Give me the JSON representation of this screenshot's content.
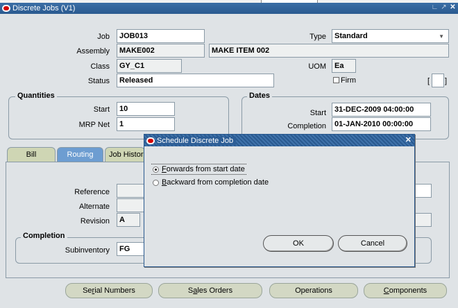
{
  "window": {
    "title": "Discrete Jobs (V1)"
  },
  "header": {
    "job_label": "Job",
    "job_value": "JOB013",
    "type_label": "Type",
    "type_value": "Standard",
    "assembly_label": "Assembly",
    "assembly_value": "MAKE002",
    "assembly_desc": "MAKE ITEM 002",
    "class_label": "Class",
    "class_value": "GY_C1",
    "uom_label": "UOM",
    "uom_value": "Ea",
    "status_label": "Status",
    "status_value": "Released",
    "firm_label": "Firm",
    "bracket_left": "[",
    "bracket_right": "]"
  },
  "quantities": {
    "title": "Quantities",
    "start_label": "Start",
    "start_value": "10",
    "mrp_label": "MRP Net",
    "mrp_value": "1"
  },
  "dates": {
    "title": "Dates",
    "start_label": "Start",
    "start_value": "31-DEC-2009 04:00:00",
    "completion_label": "Completion",
    "completion_value": "01-JAN-2010 00:00:00"
  },
  "tabs": [
    {
      "label": "Bill"
    },
    {
      "label": "Routing"
    },
    {
      "label": "Job Histor"
    }
  ],
  "routing": {
    "reference_label": "Reference",
    "alternate_label": "Alternate",
    "revision_label": "Revision",
    "revision_value": "A",
    "completion_title": "Completion",
    "subinventory_label": "Subinventory",
    "subinventory_value": "FG"
  },
  "buttons": {
    "serial_pre": "Se",
    "serial_u": "r",
    "serial_post": "ial Numbers",
    "sales_pre": "S",
    "sales_u": "a",
    "sales_post": "les Orders",
    "operations": "Operations",
    "components_pre": "",
    "components_u": "C",
    "components_post": "omponents"
  },
  "dialog": {
    "title": "Schedule Discrete Job",
    "forward_u": "F",
    "forward_rest": "orwards from start date",
    "backward_u": "B",
    "backward_rest": "ackward from completion date",
    "ok": "OK",
    "cancel": "Cancel"
  }
}
